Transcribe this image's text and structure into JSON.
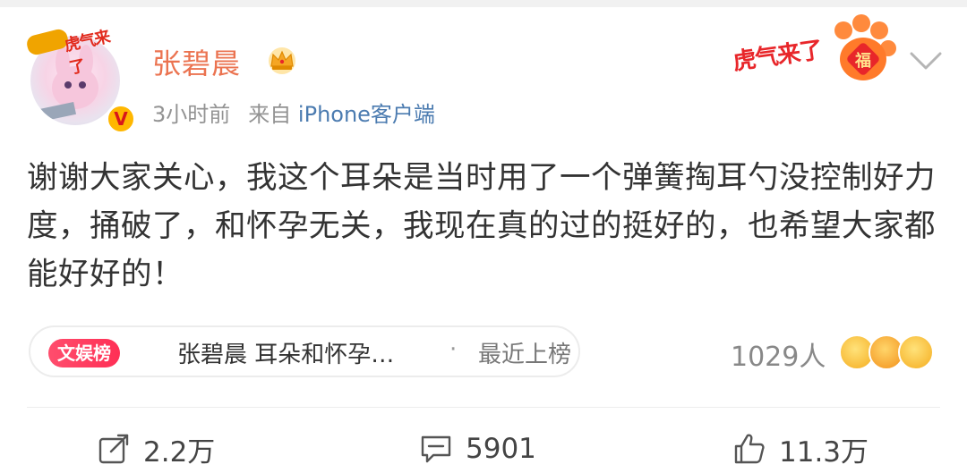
{
  "post": {
    "author": {
      "name": "张碧晨",
      "avatar_frame_text": "虎气来了",
      "verified_mark": "V"
    },
    "meta": {
      "time": "3小时前",
      "source_prefix": "来自",
      "source_client": "iPhone客户端"
    },
    "header_badge": {
      "text": "虎气来了",
      "badge_char": "福"
    },
    "text": "谢谢大家关心，我这个耳朵是当时用了一个弹簧掏耳勺没控制好力度，捅破了，和怀孕无关，我现在真的过的挺好的，也希望大家都能好好的！",
    "topic": {
      "tag": "文娱榜",
      "title": "张碧晨 耳朵和怀孕…",
      "dot": "·",
      "status": "最近上榜"
    },
    "reactions": {
      "count": "1029人"
    },
    "actions": {
      "repost": "2.2万",
      "comment": "5901",
      "like": "11.3万"
    }
  },
  "colors": {
    "username": "#eb7350",
    "client_link": "#4b7bb0",
    "topic_tag": "#ff2f55"
  },
  "icons": [
    "crown-icon",
    "chevron-down-icon",
    "repost-icon",
    "comment-icon",
    "like-icon",
    "verified-icon"
  ]
}
